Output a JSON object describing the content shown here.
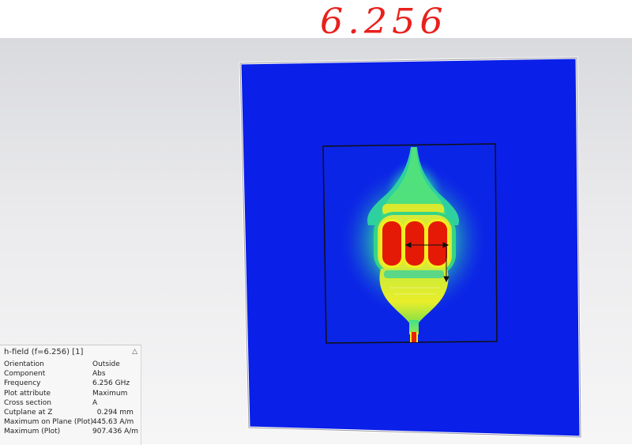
{
  "annotation": {
    "handwritten_value": "6.256"
  },
  "colors": {
    "background_top": "#d9dade",
    "substrate_blue": "#0a1ee6",
    "field_max": "#e61a05",
    "field_mid": "#e8ef20",
    "field_low": "#2fd58a"
  },
  "info_panel": {
    "title": "h-field (f=6.256) [1]",
    "collapse_icon": "chevron-up-icon",
    "rows": [
      {
        "key": "Orientation",
        "value": "Outside"
      },
      {
        "key": "Component",
        "value": "Abs"
      },
      {
        "key": "Frequency",
        "value": "6.256 GHz"
      },
      {
        "key": "Plot attribute",
        "value": "Maximum"
      },
      {
        "key": "Cross section",
        "value": "A"
      },
      {
        "key": "Cutplane at Z",
        "value": "  0.294 mm"
      },
      {
        "key": "Maximum on Plane (Plot)",
        "value": "445.63 A/m"
      },
      {
        "key": "Maximum (Plot)",
        "value": "907.436 A/m"
      }
    ]
  }
}
